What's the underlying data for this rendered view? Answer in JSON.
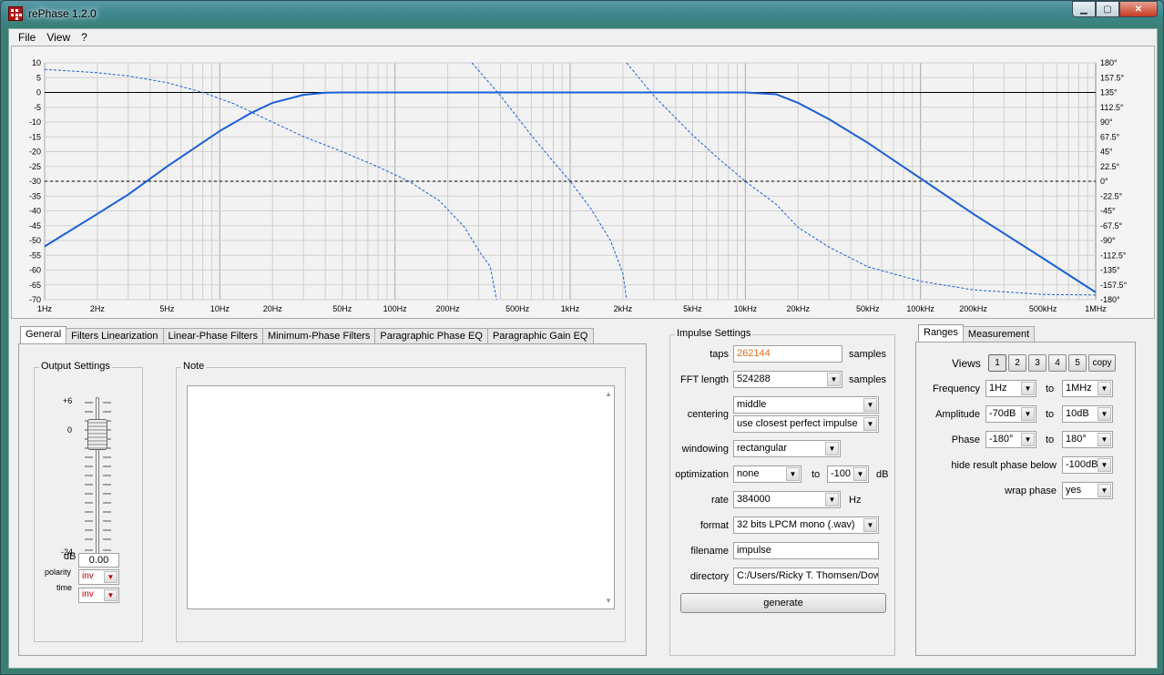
{
  "window": {
    "title": "rePhase 1.2.0"
  },
  "menu": [
    "File",
    "View",
    "?"
  ],
  "plot": {
    "left_ticks": [
      "10",
      "5",
      "0",
      "-5",
      "-10",
      "-15",
      "-20",
      "-25",
      "-30",
      "-35",
      "-40",
      "-45",
      "-50",
      "-55",
      "-60",
      "-65",
      "-70"
    ],
    "right_ticks": [
      "180°",
      "157.5°",
      "135°",
      "112.5°",
      "90°",
      "67.5°",
      "45°",
      "22.5°",
      "0°",
      "-22.5°",
      "-45°",
      "-67.5°",
      "-90°",
      "-112.5°",
      "-135°",
      "-157.5°",
      "-180°"
    ],
    "x_ticks": [
      "1Hz",
      "2Hz",
      "5Hz",
      "10Hz",
      "20Hz",
      "50Hz",
      "100Hz",
      "200Hz",
      "500Hz",
      "1kHz",
      "2kHz",
      "5kHz",
      "10kHz",
      "20kHz",
      "50kHz",
      "100kHz",
      "200kHz",
      "500kHz",
      "1MHz"
    ],
    "x_tick_values": [
      1,
      2,
      5,
      10,
      20,
      50,
      100,
      200,
      500,
      1000,
      2000,
      5000,
      10000,
      20000,
      50000,
      100000,
      200000,
      500000,
      1000000
    ],
    "xlim": [
      1,
      1000000
    ],
    "amplitude_range_db": [
      -70,
      10
    ],
    "phase_range_deg": [
      -180,
      180
    ],
    "magnitude_curve": {
      "style": "solid",
      "color": "#1a5fd6",
      "points": [
        [
          1,
          -52
        ],
        [
          2,
          -41
        ],
        [
          3,
          -34.5
        ],
        [
          5,
          -25
        ],
        [
          10,
          -13
        ],
        [
          15,
          -7
        ],
        [
          20,
          -3.5
        ],
        [
          30,
          -0.8
        ],
        [
          40,
          -0.1
        ],
        [
          50,
          0
        ],
        [
          10000,
          0
        ],
        [
          15000,
          -0.6
        ],
        [
          20000,
          -3.5
        ],
        [
          30000,
          -9
        ],
        [
          50000,
          -17
        ],
        [
          100000,
          -29
        ],
        [
          200000,
          -41
        ],
        [
          500000,
          -56
        ],
        [
          1000000,
          -67.5
        ]
      ]
    },
    "phase_curves": [
      {
        "style": "dashed",
        "color": "#1a5fd6",
        "points": [
          [
            1,
            170
          ],
          [
            2,
            165
          ],
          [
            3,
            160
          ],
          [
            5,
            150
          ],
          [
            8,
            135
          ],
          [
            12,
            118
          ],
          [
            20,
            90
          ],
          [
            30,
            68
          ],
          [
            50,
            45
          ],
          [
            80,
            22
          ],
          [
            120,
            0
          ],
          [
            180,
            -30
          ],
          [
            250,
            -70
          ],
          [
            300,
            -105
          ],
          [
            350,
            -130
          ],
          [
            380,
            -180
          ]
        ]
      },
      {
        "style": "dashed",
        "color": "#1a5fd6",
        "points": [
          [
            275,
            180
          ],
          [
            400,
            130
          ],
          [
            600,
            70
          ],
          [
            800,
            30
          ],
          [
            1000,
            0
          ],
          [
            1300,
            -40
          ],
          [
            1700,
            -90
          ],
          [
            2000,
            -140
          ],
          [
            2100,
            -180
          ]
        ]
      },
      {
        "style": "dashed",
        "color": "#1a5fd6",
        "points": [
          [
            2100,
            180
          ],
          [
            3000,
            130
          ],
          [
            5000,
            70
          ],
          [
            7000,
            35
          ],
          [
            10000,
            0
          ],
          [
            15000,
            -35
          ],
          [
            20000,
            -70
          ],
          [
            30000,
            -100
          ],
          [
            50000,
            -130
          ],
          [
            100000,
            -152
          ],
          [
            200000,
            -165
          ],
          [
            500000,
            -172
          ],
          [
            1000000,
            -173
          ]
        ]
      }
    ]
  },
  "left_tabs": [
    "General",
    "Filters Linearization",
    "Linear-Phase Filters",
    "Minimum-Phase Filters",
    "Paragraphic Phase EQ",
    "Paragraphic Gain EQ"
  ],
  "output_settings": {
    "title": "Output Settings",
    "scale_top": "+6",
    "scale_zero": "0",
    "scale_bottom": "-24",
    "db_label": "dB",
    "db_value": "0.00",
    "polarity_label": "polarity",
    "polarity_value": "inv",
    "time_label": "time",
    "time_value": "inv"
  },
  "note": {
    "title": "Note"
  },
  "impulse": {
    "title": "Impulse Settings",
    "taps_label": "taps",
    "taps_value": "262144",
    "taps_unit": "samples",
    "fft_label": "FFT length",
    "fft_value": "524288",
    "fft_unit": "samples",
    "centering_label": "centering",
    "centering_value1": "middle",
    "centering_value2": "use closest perfect impulse",
    "windowing_label": "windowing",
    "windowing_value": "rectangular",
    "optimization_label": "optimization",
    "optimization_value": "none",
    "optimization_to": "to",
    "optimization_db": "-100",
    "optimization_unit": "dB",
    "rate_label": "rate",
    "rate_value": "384000",
    "rate_unit": "Hz",
    "format_label": "format",
    "format_value": "32 bits LPCM mono (.wav)",
    "filename_label": "filename",
    "filename_value": "impulse",
    "directory_label": "directory",
    "directory_value": "C:/Users/Ricky T. Thomsen/Dow",
    "generate_label": "generate"
  },
  "right_tabs": [
    "Ranges",
    "Measurement"
  ],
  "ranges": {
    "views_label": "Views",
    "views": [
      "1",
      "2",
      "3",
      "4",
      "5"
    ],
    "copy_label": "copy",
    "frequency_label": "Frequency",
    "frequency_from": "1Hz",
    "frequency_to": "1MHz",
    "amplitude_label": "Amplitude",
    "amplitude_from": "-70dB",
    "amplitude_to": "10dB",
    "phase_label": "Phase",
    "phase_from": "-180°",
    "phase_to": "180°",
    "to_label": "to",
    "hide_label": "hide result phase below",
    "hide_value": "-100dB",
    "wrap_label": "wrap phase",
    "wrap_value": "yes"
  }
}
